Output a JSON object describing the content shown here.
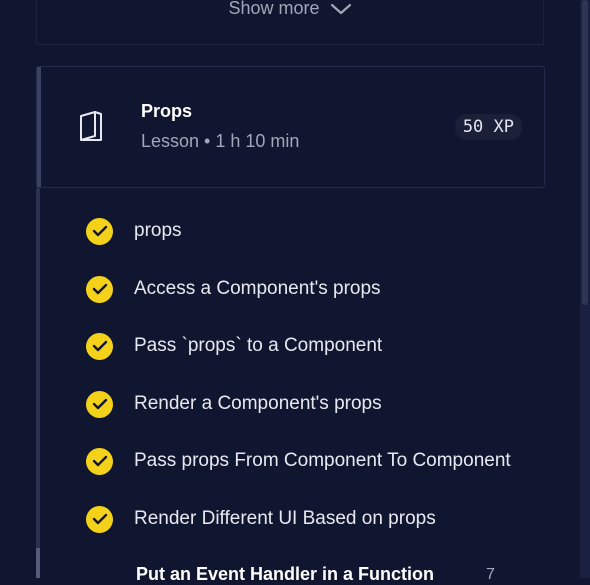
{
  "show_more": {
    "label": "Show more"
  },
  "lesson": {
    "title": "Props",
    "meta": "Lesson • 1 h 10 min",
    "xp": "50 XP"
  },
  "checklist": {
    "items": [
      {
        "label": "props",
        "done": true
      },
      {
        "label": "Access a Component's props",
        "done": true
      },
      {
        "label": "Pass `props` to a Component",
        "done": true
      },
      {
        "label": "Render a Component's props",
        "done": true
      },
      {
        "label": "Pass props From Component To Component",
        "done": true
      },
      {
        "label": "Render Different UI Based on props",
        "done": true
      }
    ]
  },
  "next_lesson": {
    "title": "Put an Event Handler in a Function",
    "xp_fragment": "7"
  },
  "colors": {
    "background": "#10162f",
    "check": "#f5d21a",
    "text": "#e8e9f0"
  },
  "icons": {
    "lesson": "book-icon",
    "check": "checkmark-icon",
    "expand": "chevron-down-icon"
  }
}
